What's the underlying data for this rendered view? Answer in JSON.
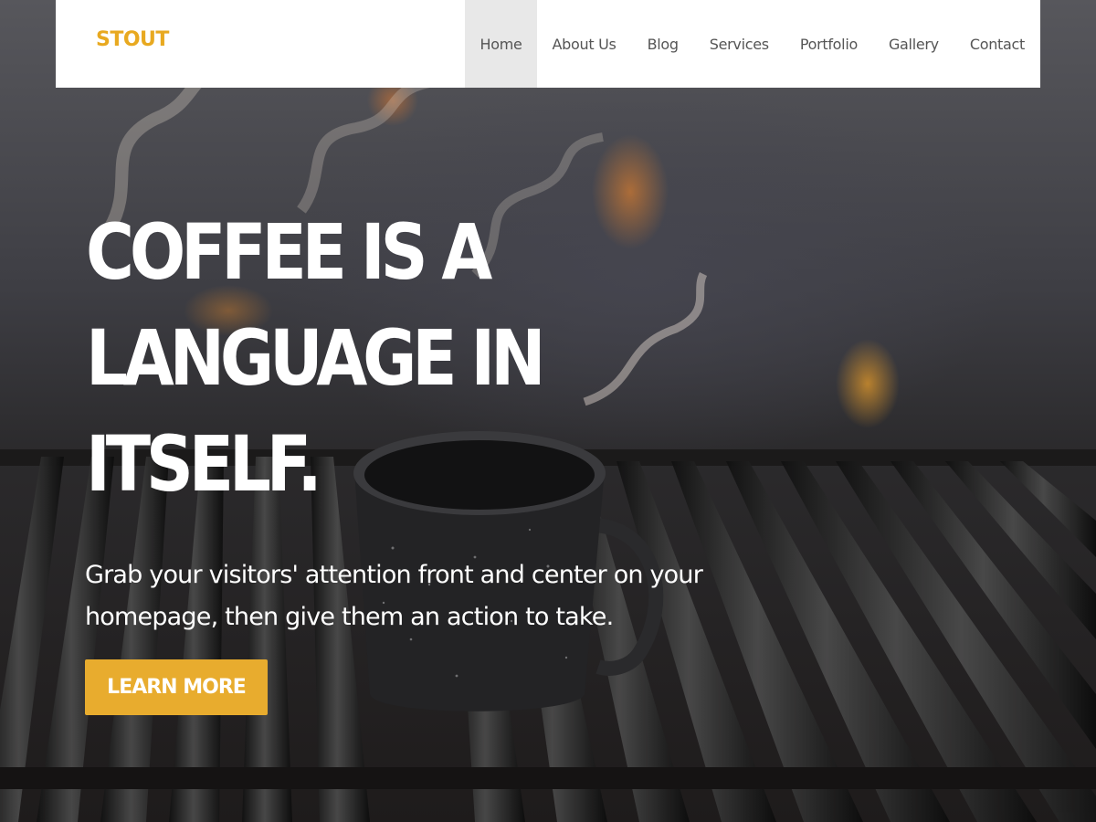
{
  "brand": {
    "name": "STOUT",
    "color": "#e8a920"
  },
  "nav": {
    "items": [
      {
        "label": "Home",
        "active": true
      },
      {
        "label": "About Us",
        "active": false
      },
      {
        "label": "Blog",
        "active": false
      },
      {
        "label": "Services",
        "active": false
      },
      {
        "label": "Portfolio",
        "active": false
      },
      {
        "label": "Gallery",
        "active": false
      },
      {
        "label": "Contact",
        "active": false
      }
    ]
  },
  "hero": {
    "headline_lines": [
      "COFFEE IS A",
      "LANGUAGE IN",
      "ITSELF."
    ],
    "subtext_lines": [
      "Grab your visitors' attention front and center on your",
      "homepage, then give them an action to take."
    ],
    "cta_label": "LEARN MORE",
    "cta_color": "#e8ac2e",
    "background_image": "coffee mug on grill grate with fire and smoke"
  }
}
